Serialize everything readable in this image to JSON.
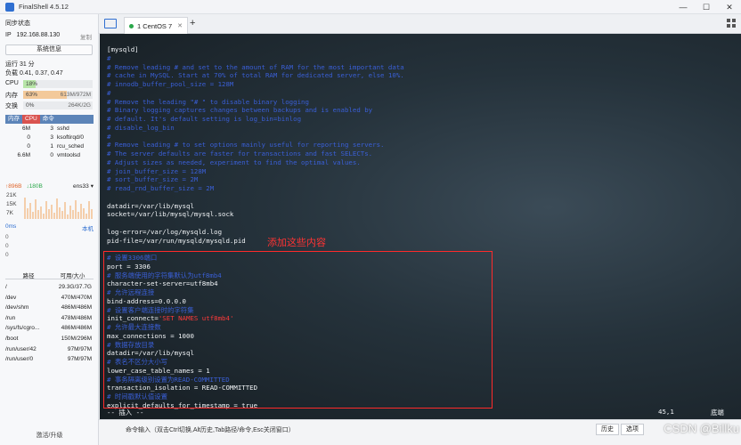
{
  "window": {
    "title": "FinalShell 4.5.12",
    "controls": [
      "—",
      "☐",
      "✕"
    ]
  },
  "sidebar": {
    "sync_status": "同步状态",
    "ip_label": "IP",
    "ip": "192.168.88.130",
    "copy": "复制",
    "sysinfo_button": "系统信息",
    "uptime": "运行 31 分",
    "load": "负载 0.41, 0.37, 0.47",
    "cpu": {
      "label": "CPU",
      "percent": "18%",
      "fraction": 0.18
    },
    "mem": {
      "label": "内存",
      "percent": "63%",
      "value": "613M/972M",
      "fraction": 0.63
    },
    "swap": {
      "label": "交换",
      "percent": "0%",
      "value": "264K/2G",
      "fraction": 0.0
    },
    "proc_headers": [
      "内存",
      "CPU",
      "命令"
    ],
    "processes": [
      {
        "mem": "6M",
        "cpu": "3",
        "cmd": "sshd"
      },
      {
        "mem": "0",
        "cpu": "3",
        "cmd": "ksoftirqd/0"
      },
      {
        "mem": "0",
        "cpu": "1",
        "cmd": "rcu_sched"
      },
      {
        "mem": "6.6M",
        "cpu": "0",
        "cmd": "vmtoolsd"
      }
    ],
    "net": {
      "up": "↑896B",
      "down": "↓180B",
      "iface": "ens33",
      "y_ticks": [
        "21K",
        "15K",
        "7K"
      ]
    },
    "latency": {
      "value": "0ms",
      "host": "本机",
      "ticks": [
        "0",
        "0",
        "0"
      ]
    },
    "disk_headers": [
      "路径",
      "可用/大小"
    ],
    "disks": [
      {
        "path": "/",
        "size": "29.3G/37.7G"
      },
      {
        "path": "/dev",
        "size": "470M/470M"
      },
      {
        "path": "/dev/shm",
        "size": "486M/486M"
      },
      {
        "path": "/run",
        "size": "478M/486M"
      },
      {
        "path": "/sys/fs/cgro...",
        "size": "486M/486M"
      },
      {
        "path": "/boot",
        "size": "150M/296M"
      },
      {
        "path": "/run/user/42",
        "size": "97M/97M"
      },
      {
        "path": "/run/user/0",
        "size": "97M/97M"
      }
    ],
    "footer": "激活/升级"
  },
  "tabs": [
    {
      "label": "1 CentOS 7",
      "active": true
    }
  ],
  "terminal": {
    "lines": [
      {
        "t": "[mysqld]",
        "c": "plain"
      },
      {
        "t": "#",
        "c": "comment"
      },
      {
        "t": "# Remove leading # and set to the amount of RAM for the most important data",
        "c": "comment"
      },
      {
        "t": "# cache in MySQL. Start at 70% of total RAM for dedicated server, else 10%.",
        "c": "comment"
      },
      {
        "t": "# innodb_buffer_pool_size = 128M",
        "c": "comment"
      },
      {
        "t": "#",
        "c": "comment"
      },
      {
        "t": "# Remove the leading \"# \" to disable binary logging",
        "c": "comment"
      },
      {
        "t": "# Binary logging captures changes between backups and is enabled by",
        "c": "comment"
      },
      {
        "t": "# default. It's default setting is log_bin=binlog",
        "c": "comment"
      },
      {
        "t": "# disable_log_bin",
        "c": "comment"
      },
      {
        "t": "#",
        "c": "comment"
      },
      {
        "t": "# Remove leading # to set options mainly useful for reporting servers.",
        "c": "comment"
      },
      {
        "t": "# The server defaults are faster for transactions and fast SELECTs.",
        "c": "comment"
      },
      {
        "t": "# Adjust sizes as needed, experiment to find the optimal values.",
        "c": "comment"
      },
      {
        "t": "# join_buffer_size = 128M",
        "c": "comment"
      },
      {
        "t": "# sort_buffer_size = 2M",
        "c": "comment"
      },
      {
        "t": "# read_rnd_buffer_size = 2M",
        "c": "comment"
      },
      {
        "t": "",
        "c": "plain"
      },
      {
        "t": "datadir=/var/lib/mysql",
        "c": "plain"
      },
      {
        "t": "socket=/var/lib/mysql/mysql.sock",
        "c": "plain"
      },
      {
        "t": "",
        "c": "plain"
      },
      {
        "t": "log-error=/var/log/mysqld.log",
        "c": "plain"
      },
      {
        "t": "pid-file=/var/run/mysqld/mysqld.pid",
        "c": "plain"
      },
      {
        "t": "",
        "c": "plain"
      },
      {
        "t": "# 设置3306端口",
        "c": "comment"
      },
      {
        "t": "port = 3306",
        "c": "plain"
      },
      {
        "t": "# 服务端使用的字符集默认为utf8mb4",
        "c": "comment"
      },
      {
        "t": "character-set-server=utf8mb4",
        "c": "plain"
      },
      {
        "t": "# 允许远程连接",
        "c": "comment"
      },
      {
        "t": "bind-address=0.0.0.0",
        "c": "plain"
      },
      {
        "t": "# 设置客户端连接时的字符集",
        "c": "comment"
      },
      {
        "t": "init_connect='SET NAMES utf8mb4'",
        "c": "plain"
      },
      {
        "t": "# 允许最大连接数",
        "c": "comment"
      },
      {
        "t": "max_connections = 1000",
        "c": "plain"
      },
      {
        "t": "# 数据存放目录",
        "c": "comment"
      },
      {
        "t": "datadir=/var/lib/mysql",
        "c": "plain"
      },
      {
        "t": "# 表名不区分大小写",
        "c": "comment"
      },
      {
        "t": "lower_case_table_names = 1",
        "c": "plain"
      },
      {
        "t": "# 事务隔离级别设置为READ-COMMITTED",
        "c": "comment"
      },
      {
        "t": "transaction_isolation = READ-COMMITTED",
        "c": "plain"
      },
      {
        "t": "# 时间戳默认值设置",
        "c": "comment"
      },
      {
        "t": "explicit_defaults_for_timestamp = true",
        "c": "plain"
      }
    ],
    "annotation": "添加这些内容",
    "mode": "-- 插入 --",
    "cursor_pos": "45,1",
    "scroll_pos": "底端"
  },
  "cmdbar": {
    "hint": "命令输入（双击Ctrl切换,Alt历史,Tab路径/命令,Esc关闭窗口）",
    "buttons": [
      "历史",
      "选项"
    ],
    "watermark": "CSDN @Billku"
  }
}
